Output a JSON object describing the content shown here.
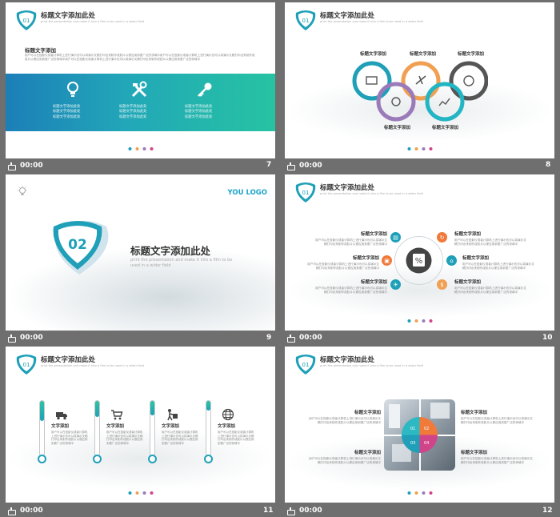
{
  "header_title": "标题文字添加此处",
  "header_sub": "print the presentation and make it into a film to be used in a wider field",
  "shield_number": "01",
  "footer_time": "00:00",
  "dot_colors": [
    "#1fa0b8",
    "#f0a052",
    "#9a7ab8",
    "#d0448a"
  ],
  "slides": [
    {
      "number": "7",
      "section_title": "标题文字添加",
      "paragraph": "用户可以在投影仪或者计算机上进行演示也可以将演示文稿打印出来制作成胶片以便应用到更广泛的领域中用户可以在投影仪或者计算机上进行演示也可以将演示文稿打印出来制作成胶片以便应用到更广泛的领域中用户可以在投影仪或者计算机上进行演示也可以将演示文稿打印出来制作成胶片以便应用到更广泛的领域中",
      "items": [
        {
          "icon": "lightbulb-icon",
          "lines": [
            "标题文字添加此处",
            "标题文字添加此处",
            "标题文字添加此处"
          ]
        },
        {
          "icon": "tools-icon",
          "lines": [
            "标题文字添加此处",
            "标题文字添加此处",
            "标题文字添加此处"
          ]
        },
        {
          "icon": "key-icon",
          "lines": [
            "标题文字添加此处",
            "标题文字添加此处",
            "标题文字添加此处"
          ]
        }
      ]
    },
    {
      "number": "8",
      "labels": [
        "标题文字添加",
        "标题文字添加",
        "标题文字添加",
        "标题文字添加",
        "标题文字添加"
      ],
      "ring_colors": [
        "#1fa0b8",
        "#f0a052",
        "#555555",
        "#9a7ab8",
        "#22b5c4"
      ]
    },
    {
      "number": "9",
      "logo": "YOU LOGO",
      "shield_number": "02",
      "title": "标题文字添加此处",
      "sub": "print the presentation and make it into a film to be used in a wider field"
    },
    {
      "number": "10",
      "center_glyph": "%",
      "blocks": [
        {
          "title": "标题文字添加",
          "body": "用户可以在投影仪或者计算机上进行演示也可以将演示文稿打印出来制作成胶片以便应用到更广泛的领域中"
        },
        {
          "title": "标题文字添加",
          "body": "用户可以在投影仪或者计算机上进行演示也可以将演示文稿打印出来制作成胶片以便应用到更广泛的领域中"
        },
        {
          "title": "标题文字添加",
          "body": "用户可以在投影仪或者计算机上进行演示也可以将演示文稿打印出来制作成胶片以便应用到更广泛的领域中"
        },
        {
          "title": "标题文字添加",
          "body": "用户可以在投影仪或者计算机上进行演示也可以将演示文稿打印出来制作成胶片以便应用到更广泛的领域中"
        },
        {
          "title": "标题文字添加",
          "body": "用户可以在投影仪或者计算机上进行演示也可以将演示文稿打印出来制作成胶片以便应用到更广泛的领域中"
        },
        {
          "title": "标题文字添加",
          "body": "用户可以在投影仪或者计算机上进行演示也可以将演示文稿打印出来制作成胶片以便应用到更广泛的领域中"
        }
      ]
    },
    {
      "number": "11",
      "columns": [
        {
          "icon": "truck-icon",
          "title": "文字添加",
          "body": "用户可以在投影仪或者计算机上进行演示也可以将演示文稿打印出来制作成胶片以便应用到更广泛的领域中"
        },
        {
          "icon": "cart-icon",
          "title": "文字添加",
          "body": "用户可以在投影仪或者计算机上进行演示也可以将演示文稿打印出来制作成胶片以便应用到更广泛的领域中"
        },
        {
          "icon": "delivery-icon",
          "title": "文字添加",
          "body": "用户可以在投影仪或者计算机上进行演示也可以将演示文稿打印出来制作成胶片以便应用到更广泛的领域中"
        },
        {
          "icon": "globe-icon",
          "title": "文字添加",
          "body": "用户可以在投影仪或者计算机上进行演示也可以将演示文稿打印出来制作成胶片以便应用到更广泛的领域中"
        }
      ]
    },
    {
      "number": "12",
      "quad_labels": [
        "01",
        "02",
        "03",
        "04"
      ],
      "blocks": [
        {
          "title": "标题文字添加",
          "body": "用户可以在投影仪或者计算机上进行演示也可以将演示文稿打印出来制作成胶片以便应用到更广泛的领域中"
        },
        {
          "title": "标题文字添加",
          "body": "用户可以在投影仪或者计算机上进行演示也可以将演示文稿打印出来制作成胶片以便应用到更广泛的领域中"
        },
        {
          "title": "标题文字添加",
          "body": "用户可以在投影仪或者计算机上进行演示也可以将演示文稿打印出来制作成胶片以便应用到更广泛的领域中"
        },
        {
          "title": "标题文字添加",
          "body": "用户可以在投影仪或者计算机上进行演示也可以将演示文稿打印出来制作成胶片以便应用到更广泛的领域中"
        }
      ]
    }
  ]
}
